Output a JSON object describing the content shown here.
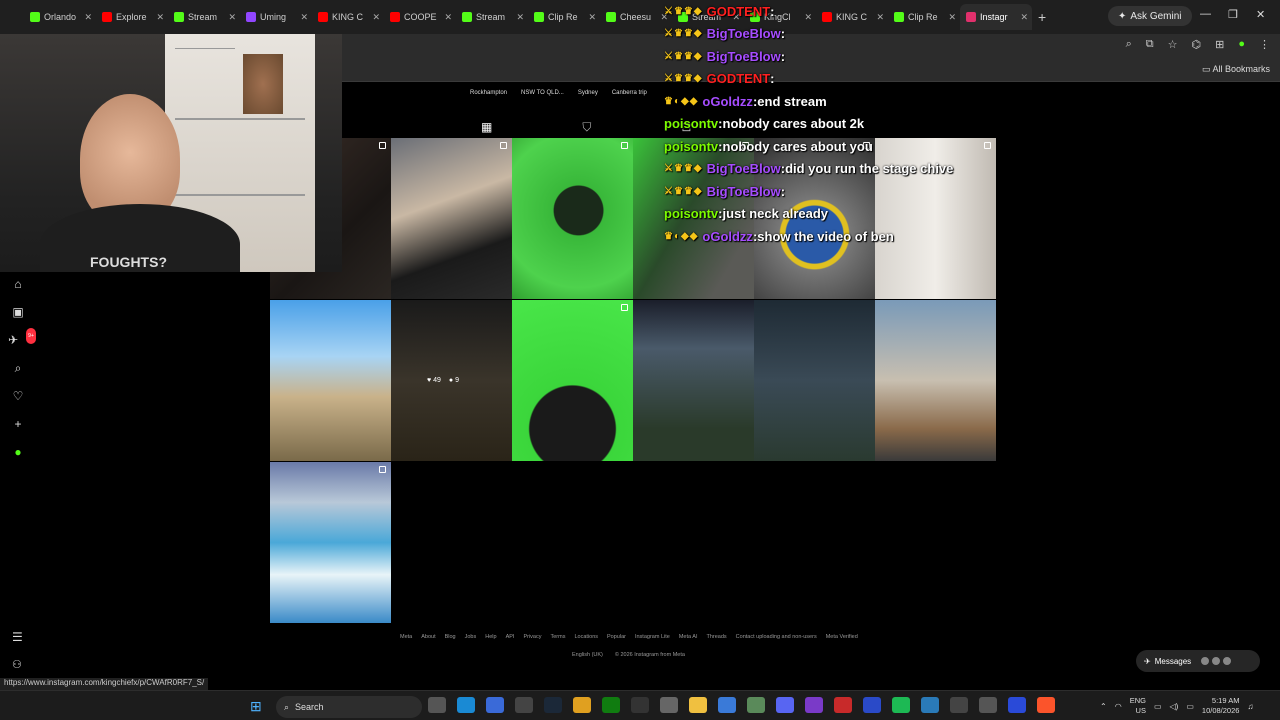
{
  "browser": {
    "tabs": [
      {
        "label": "Orlando",
        "color": "#53fc18",
        "active": false
      },
      {
        "label": "Explore",
        "color": "#ff0000",
        "active": false
      },
      {
        "label": "Stream",
        "color": "#53fc18",
        "active": false
      },
      {
        "label": "Uming",
        "color": "#9146ff",
        "active": false
      },
      {
        "label": "KING C",
        "color": "#ff0000",
        "active": false
      },
      {
        "label": "COOPE",
        "color": "#ff0000",
        "active": false
      },
      {
        "label": "Stream",
        "color": "#53fc18",
        "active": false
      },
      {
        "label": "Clip Re",
        "color": "#53fc18",
        "active": false
      },
      {
        "label": "Cheesu",
        "color": "#53fc18",
        "active": false
      },
      {
        "label": "Stream",
        "color": "#53fc18",
        "active": false
      },
      {
        "label": "KingCl",
        "color": "#53fc18",
        "active": false
      },
      {
        "label": "KING C",
        "color": "#ff0000",
        "active": false
      },
      {
        "label": "Clip Re",
        "color": "#53fc18",
        "active": false
      },
      {
        "label": "Instagr",
        "color": "#e1306c",
        "active": true
      }
    ],
    "gemini_label": "Ask Gemini",
    "all_bookmarks": "All Bookmarks",
    "status_url": "https://www.instagram.com/kingchiefx/p/CWAfR0RF7_S/"
  },
  "instagram": {
    "highlights": [
      "Rockhampton",
      "NSW TO QLD...",
      "Sydney",
      "Canberra trip"
    ],
    "nav_badge": "9+",
    "hover_post": {
      "likes": "49",
      "comments": "9"
    },
    "footer_links": [
      "Meta",
      "About",
      "Blog",
      "Jobs",
      "Help",
      "API",
      "Privacy",
      "Terms",
      "Locations",
      "Popular",
      "Instagram Lite",
      "Meta AI",
      "Threads",
      "Contact uploading and non-users",
      "Meta Verified"
    ],
    "language": "English (UK)",
    "copyright": "© 2026 Instagram from Meta",
    "messages_label": "Messages"
  },
  "chat": [
    {
      "user": "GODTENT",
      "text": "",
      "color": "#ff2020",
      "badges": "⚔♛♛◆"
    },
    {
      "user": "BigToeBlow",
      "text": "",
      "color": "#a64dff",
      "badges": "⚔♛♛◆"
    },
    {
      "user": "BigToeBlow",
      "text": "",
      "color": "#a64dff",
      "badges": "⚔♛♛◆"
    },
    {
      "user": "GODTENT",
      "text": "",
      "color": "#ff2020",
      "badges": "⚔♛♛◆"
    },
    {
      "user": "oGoldzz",
      "text": "end stream",
      "color": "#a64dff",
      "badges": "♛◐◆◆"
    },
    {
      "user": "poisontv",
      "text": "nobody cares about 2k",
      "color": "#7cfc00",
      "badges": ""
    },
    {
      "user": "poisontv",
      "text": "nobody cares about you",
      "color": "#7cfc00",
      "badges": ""
    },
    {
      "user": "BigToeBlow",
      "text": "did you run the stage chive",
      "color": "#a64dff",
      "badges": "⚔♛♛◆"
    },
    {
      "user": "BigToeBlow",
      "text": "",
      "color": "#a64dff",
      "badges": "⚔♛♛◆"
    },
    {
      "user": "poisontv",
      "text": "just neck already",
      "color": "#7cfc00",
      "badges": ""
    },
    {
      "user": "oGoldzz",
      "text": "show the video of ben",
      "color": "#a64dff",
      "badges": "♛◐◆◆"
    }
  ],
  "webcam": {
    "shirt_text": "FOUGHTS?"
  },
  "taskbar": {
    "search_label": "Search",
    "lang_top": "ENG",
    "lang_bottom": "US",
    "time": "5:19 AM",
    "date": "10/08/2026"
  },
  "colors": {
    "accent": "#0095f6",
    "bg": "#000000"
  }
}
